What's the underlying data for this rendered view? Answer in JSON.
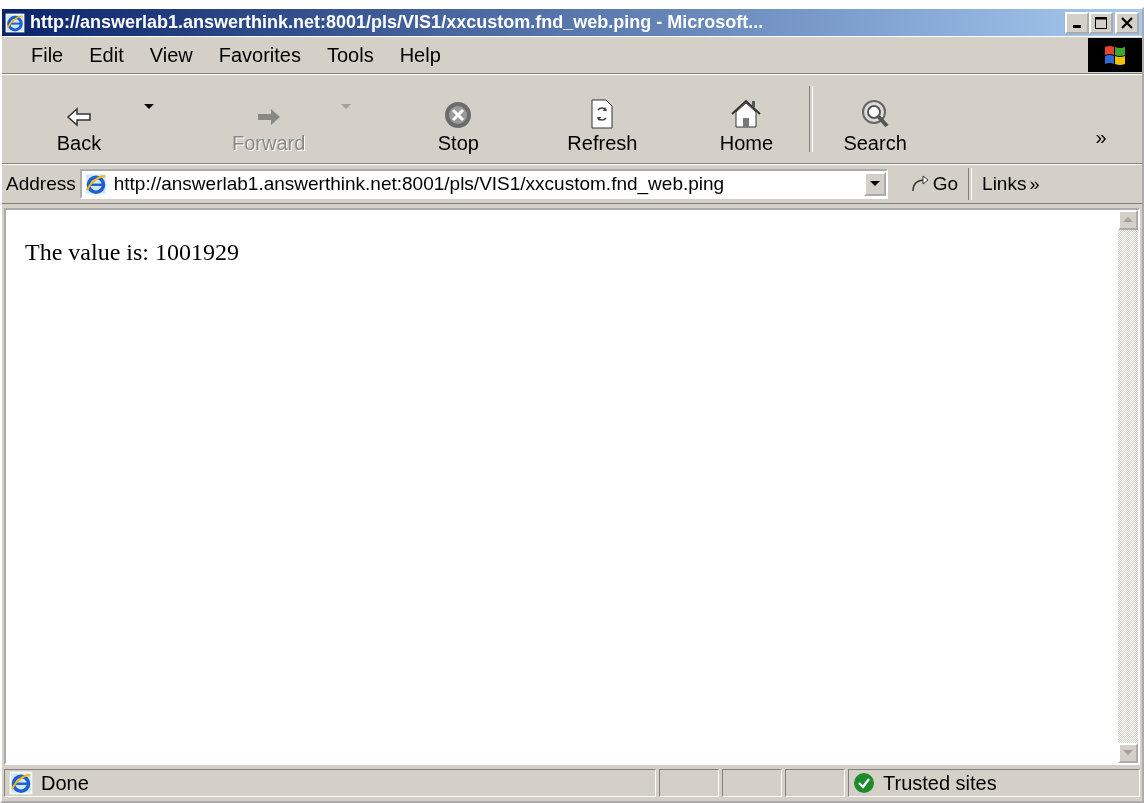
{
  "window": {
    "title": "http://answerlab1.answerthink.net:8001/pls/VIS1/xxcustom.fnd_web.ping - Microsoft..."
  },
  "menu": [
    {
      "label": "File"
    },
    {
      "label": "Edit"
    },
    {
      "label": "View"
    },
    {
      "label": "Favorites"
    },
    {
      "label": "Tools"
    },
    {
      "label": "Help"
    }
  ],
  "toolbar": [
    {
      "kind": "back",
      "label": "Back",
      "disabled": false,
      "dropdown": true
    },
    {
      "kind": "forward",
      "label": "Forward",
      "disabled": true,
      "dropdown": true
    },
    {
      "kind": "stop",
      "label": "Stop",
      "disabled": false,
      "dropdown": false
    },
    {
      "kind": "refresh",
      "label": "Refresh",
      "disabled": false,
      "dropdown": false
    },
    {
      "kind": "home",
      "label": "Home",
      "disabled": false,
      "dropdown": false
    },
    {
      "kind": "search",
      "label": "Search",
      "disabled": false,
      "dropdown": false
    }
  ],
  "toolbar_more": "»",
  "address_bar": {
    "label": "Address",
    "value": "http://answerlab1.answerthink.net:8001/pls/VIS1/xxcustom.fnd_web.ping",
    "go": "Go",
    "links": "Links",
    "links_more": "»"
  },
  "content": {
    "text": "The value is: 1001929"
  },
  "status_bar": {
    "text": "Done",
    "zone": "Trusted sites"
  }
}
